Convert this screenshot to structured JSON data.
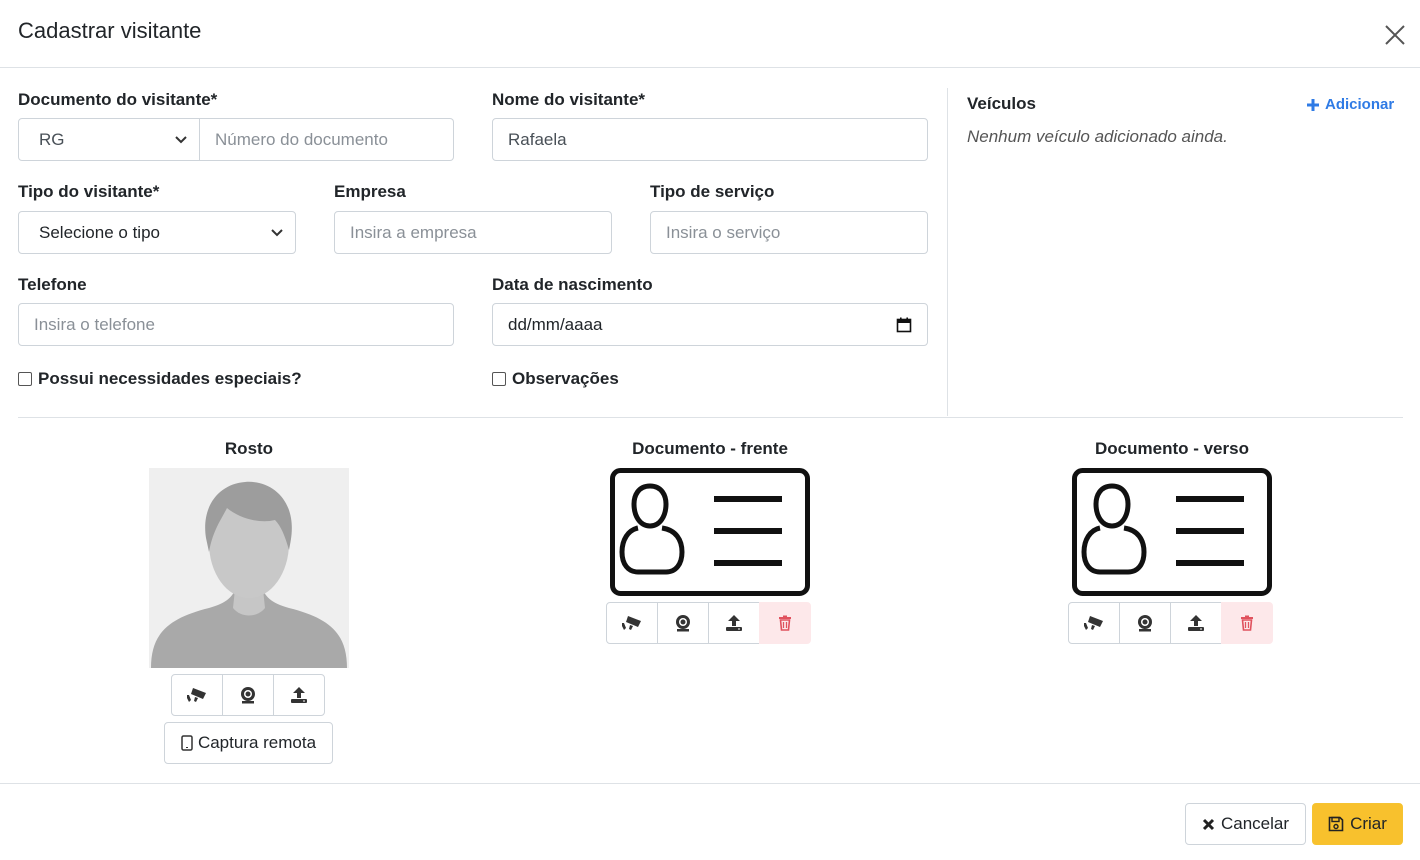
{
  "modal": {
    "title": "Cadastrar visitante"
  },
  "form": {
    "document_label": "Documento do visitante*",
    "document_type_value": "RG",
    "document_number_placeholder": "Número do documento",
    "name_label": "Nome do visitante*",
    "name_value": "Rafaela",
    "visitor_type_label": "Tipo do visitante*",
    "visitor_type_placeholder": "Selecione o tipo",
    "company_label": "Empresa",
    "company_placeholder": "Insira a empresa",
    "service_label": "Tipo de serviço",
    "service_placeholder": "Insira o serviço",
    "phone_label": "Telefone",
    "phone_placeholder": "Insira o telefone",
    "birth_label": "Data de nascimento",
    "birth_placeholder": "dd/mm/aaaa",
    "special_needs_label": "Possui necessidades especiais?",
    "notes_label": "Observações"
  },
  "vehicles": {
    "title": "Veículos",
    "add_label": "Adicionar",
    "empty_text": "Nenhum veículo adicionado ainda."
  },
  "media": {
    "face_title": "Rosto",
    "doc_front_title": "Documento - frente",
    "doc_back_title": "Documento - verso",
    "remote_capture_label": "Captura remota"
  },
  "footer": {
    "cancel_label": "Cancelar",
    "create_label": "Criar"
  },
  "colors": {
    "accent_link": "#2f7be5",
    "primary_button": "#f8c12d",
    "danger_bg": "#fde8ea",
    "danger_icon": "#e0525e"
  }
}
